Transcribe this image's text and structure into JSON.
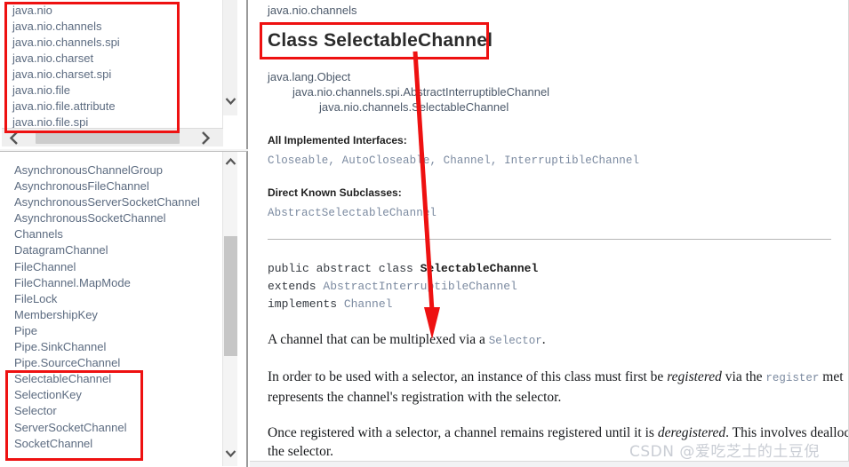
{
  "packages_panel": {
    "name": "packages-frame",
    "items": [
      "java.nio",
      "java.nio.channels",
      "java.nio.channels.spi",
      "java.nio.charset",
      "java.nio.charset.spi",
      "java.nio.file",
      "java.nio.file.attribute",
      "java.nio.file.spi"
    ],
    "scroll": {
      "vertical_arrow_down_icon": "chevron-down-icon",
      "horizontal_arrow_left_icon": "chevron-left-icon",
      "horizontal_arrow_right_icon": "chevron-right-icon"
    }
  },
  "classes_panel": {
    "name": "classes-frame",
    "items": [
      "AsynchronousChannelGroup",
      "AsynchronousFileChannel",
      "AsynchronousServerSocketChannel",
      "AsynchronousSocketChannel",
      "Channels",
      "DatagramChannel",
      "FileChannel",
      "FileChannel.MapMode",
      "FileLock",
      "MembershipKey",
      "Pipe",
      "Pipe.SinkChannel",
      "Pipe.SourceChannel",
      "SelectableChannel",
      "SelectionKey",
      "Selector",
      "ServerSocketChannel",
      "SocketChannel"
    ],
    "scroll": {
      "vertical_arrow_up_icon": "chevron-up-icon",
      "vertical_arrow_down_icon": "chevron-down-icon"
    }
  },
  "doc": {
    "package_name": "java.nio.channels",
    "title": "Class SelectableChannel",
    "hierarchy": [
      {
        "level": 1,
        "plain": "java.lang.Object",
        "link": ""
      },
      {
        "level": 2,
        "plain": "java.nio.channels.spi.",
        "link": "AbstractInterruptibleChannel"
      },
      {
        "level": 3,
        "plain": "java.nio.channels.SelectableChannel",
        "link": ""
      }
    ],
    "implemented_interfaces_label": "All Implemented Interfaces:",
    "implemented_interfaces": [
      "Closeable",
      "AutoCloseable",
      "Channel",
      "InterruptibleChannel"
    ],
    "subclasses_label": "Direct Known Subclasses:",
    "subclasses": [
      "AbstractSelectableChannel"
    ],
    "signature": {
      "line1_kw": "public abstract class ",
      "line1_name": "SelectableChannel",
      "line2_kw": "extends ",
      "line2_link": "AbstractInterruptibleChannel",
      "line3_kw": "implements ",
      "line3_link": "Channel"
    },
    "paragraphs": [
      {
        "id": "p1",
        "pre": "A channel that can be multiplexed via a ",
        "code": "Selector",
        "post": "."
      },
      {
        "id": "p2",
        "pre": "In order to be used with a selector, an instance of this class must first be ",
        "em": "registered",
        "mid": " via the ",
        "code": "register",
        "post": " met",
        "line2": "represents the channel's registration with the selector."
      },
      {
        "id": "p3",
        "pre": "Once registered with a selector, a channel remains registered until it is ",
        "em": "deregistered",
        "post": ". This involves dealloc",
        "line2": "the selector."
      }
    ]
  },
  "annotations": {
    "color": "#ee1111",
    "boxes": [
      "packages-highlight",
      "classes-highlight",
      "title-highlight"
    ],
    "arrow": "title-to-description-arrow"
  },
  "watermark": {
    "text": "CSDN @爱吃芝士的土豆倪"
  }
}
